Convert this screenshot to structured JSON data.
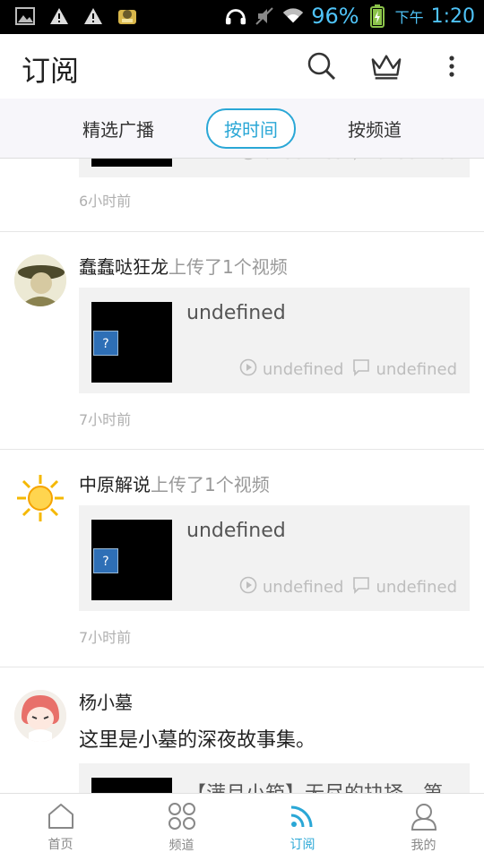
{
  "status_bar": {
    "battery_percent": "96%",
    "ampm": "下午",
    "time": "1:20",
    "icons": [
      "image-icon",
      "warning-icon",
      "warning-icon",
      "app-icon",
      "headphones-icon",
      "mute-icon",
      "wifi-icon",
      "battery-icon"
    ]
  },
  "header": {
    "title": "订阅",
    "search_icon": "search-icon",
    "crown_icon": "crown-icon",
    "more_icon": "more-vert-icon"
  },
  "tabs": {
    "items": [
      {
        "label": "精选广播"
      },
      {
        "label": "按时间"
      },
      {
        "label": "按频道"
      }
    ],
    "active": "按时间"
  },
  "feed": {
    "partial_post": {
      "time": "6小时前",
      "meta_play": "undefined",
      "meta_comment": "undefined"
    },
    "posts": [
      {
        "author": "蠢蠢哒狂龙",
        "action": "上传了1个视频",
        "card_title": "undefined",
        "meta_play": "undefined",
        "meta_comment": "undefined",
        "time": "7小时前"
      },
      {
        "author": "中原解说",
        "action": "上传了1个视频",
        "card_title": "undefined",
        "meta_play": "undefined",
        "meta_comment": "undefined",
        "time": "7小时前"
      },
      {
        "author": "杨小墓",
        "description": "这里是小墓的深夜故事集。",
        "card_title": "【满月小箱】无尽的抉择，第"
      }
    ]
  },
  "bottom_nav": {
    "items": [
      {
        "label": "首页",
        "icon": "home-icon"
      },
      {
        "label": "频道",
        "icon": "channels-icon"
      },
      {
        "label": "订阅",
        "icon": "subscribe-icon"
      },
      {
        "label": "我的",
        "icon": "profile-icon"
      }
    ],
    "active": "订阅"
  },
  "colors": {
    "accent": "#2aa7d6",
    "status_bar_bg": "#000000",
    "status_icons": "#4fc3f7",
    "tabs_bg": "#f7f6fa",
    "card_bg": "#f2f2f2"
  }
}
